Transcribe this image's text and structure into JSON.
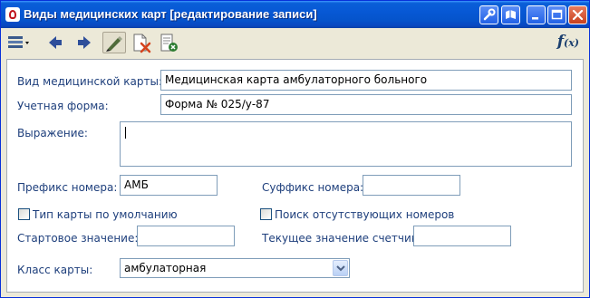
{
  "window": {
    "title": "Виды медицинских карт [редактирование записи]"
  },
  "toolbar": {
    "icons": [
      "list-view-icon",
      "chevron-down-icon",
      "arrow-left-icon",
      "arrow-right-icon",
      "edit-pencil-icon",
      "delete-document-icon",
      "close-document-icon"
    ],
    "formula_icon": "f",
    "formula_icon_sub": "(x)"
  },
  "form": {
    "card_type_label": "Вид медицинской карты:",
    "card_type_value": "Медицинская карта амбулаторного больного",
    "account_form_label": "Учетная форма:",
    "account_form_value": "Форма № 025/у-87",
    "expression_label": "Выражение:",
    "expression_value": "",
    "prefix_label": "Префикс номера:",
    "prefix_value": "АМБ",
    "suffix_label": "Суффикс номера:",
    "suffix_value": "",
    "default_type_label": "Тип карты по умолчанию",
    "default_type_checked": false,
    "search_missing_label": "Поиск отсутствующих номеров",
    "search_missing_checked": false,
    "start_value_label": "Стартовое значение:",
    "start_value": "",
    "current_counter_label": "Текущее значение счетчика:",
    "current_counter_value": "",
    "card_class_label": "Класс карты:",
    "card_class_value": "амбулаторная"
  },
  "colors": {
    "title_bar": "#0758D5",
    "label_text": "#1E3F7C",
    "window_bg": "#ECE9D8"
  }
}
